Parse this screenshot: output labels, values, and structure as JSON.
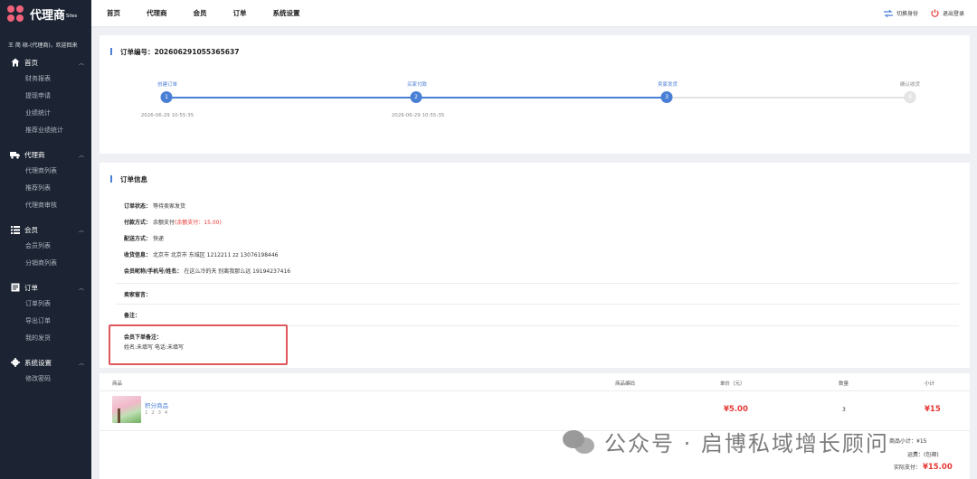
{
  "app": {
    "logo_text": "代理商",
    "logo_sub": "Sites",
    "welcome": "王 简 硕-(代理商)，欢迎回来"
  },
  "sidebar": {
    "groups": [
      {
        "label": "首页",
        "icon": "home-icon",
        "items": [
          "财务报表",
          "提现申请",
          "业绩统计",
          "推荐业绩统计"
        ]
      },
      {
        "label": "代理商",
        "icon": "truck-icon",
        "items": [
          "代理商列表",
          "推荐列表",
          "代理商审核"
        ]
      },
      {
        "label": "会员",
        "icon": "list-icon",
        "items": [
          "会员列表",
          "分销商列表"
        ]
      },
      {
        "label": "订单",
        "icon": "document-icon",
        "items": [
          "订单列表",
          "导出订单",
          "我的发货"
        ]
      },
      {
        "label": "系统设置",
        "icon": "gear-icon",
        "items": [
          "修改密码"
        ]
      }
    ]
  },
  "topbar": {
    "nav": [
      "首页",
      "代理商",
      "会员",
      "订单",
      "系统设置"
    ],
    "switch_label": "切换身份",
    "logout_label": "退出登录"
  },
  "order": {
    "title_prefix": "订单编号：",
    "order_no": "202606291055365637",
    "steps": [
      {
        "label": "创建订单",
        "num": "1",
        "time": "2026-06-29 10:55:35",
        "done": true
      },
      {
        "label": "买家付款",
        "num": "2",
        "time": "2026-06-29 10:55:35",
        "done": true
      },
      {
        "label": "卖家发货",
        "num": "3",
        "time": "",
        "done": true
      },
      {
        "label": "确认收货",
        "num": "4",
        "time": "",
        "done": false
      }
    ]
  },
  "info": {
    "title": "订单信息",
    "status_label": "订单状态：",
    "status_value": "等待卖家发货",
    "pay_label": "付款方式：",
    "pay_value": "余额支付",
    "pay_extra": "(余额支付：15.00)",
    "ship_label": "配送方式：",
    "ship_value": "快递",
    "recv_label": "收货信息：",
    "recv_value": "北京市 北京市 东城区 1212211   zz   13076198446",
    "member_label": "会员昵称/手机号/姓名：",
    "member_value": "在这么冷的天 别离我那么远   19194237416",
    "seller_note_label": "卖家留言：",
    "remark_label": "备注：",
    "member_note_label": "会员下单备注：",
    "member_note_value": "姓名:未填写 电话:未填写"
  },
  "goods": {
    "headers": {
      "goods": "商品",
      "code": "商品编码",
      "price": "单价（元）",
      "qty": "数量",
      "subtotal": "小计"
    },
    "rows": [
      {
        "name": "积分商品",
        "sub": "1 2 3 4",
        "price": "¥5.00",
        "qty": "3",
        "subtotal": "¥15"
      }
    ],
    "summary": {
      "goods_total_label": "商品小计：",
      "goods_total_value": "¥15",
      "freight_label": "运费：",
      "freight_value": "(包邮)",
      "paid_label": "实际支付：",
      "paid_value": "¥15.00"
    }
  },
  "watermark": {
    "text": "公众号 · 启博私域增长顾问"
  }
}
